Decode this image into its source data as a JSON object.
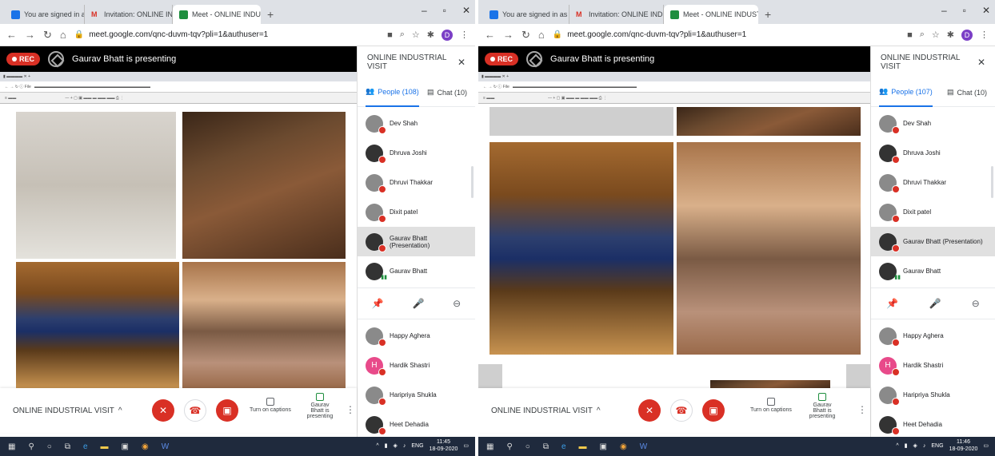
{
  "screens": [
    {
      "tabs": [
        {
          "label": "You are signed in as ce.dmm",
          "icon_color": "#1a73e8"
        },
        {
          "label": "Invitation: ONLINE INDUSTRIAL",
          "icon_color": "#d93025"
        },
        {
          "label": "Meet - ONLINE INDUSTRIAL",
          "icon_color": "#1e8e3e"
        }
      ],
      "url": "meet.google.com/qnc-duvm-tqv?pli=1&authuser=1",
      "presenter_banner": "Gaurav Bhatt is presenting",
      "rec_label": "REC",
      "panel_title": "ONLINE INDUSTRIAL VISIT",
      "people_tab": "People (108)",
      "chat_tab": "Chat (10)",
      "participants_top": [
        {
          "name": "Dev Shah"
        },
        {
          "name": "Dhruva Joshi"
        },
        {
          "name": "Dhruvi Thakkar"
        },
        {
          "name": "Dixit patel"
        },
        {
          "name": "Gaurav Bhatt (Presentation)"
        },
        {
          "name": "Gaurav Bhatt"
        }
      ],
      "participants_bottom": [
        {
          "name": "Happy Aghera"
        },
        {
          "name": "Hardik Shastri",
          "initial": "H"
        },
        {
          "name": "Haripriya Shukla"
        },
        {
          "name": "Heet Dehadia"
        }
      ],
      "meeting_name": "ONLINE INDUSTRIAL VISIT",
      "captions_label": "Turn on captions",
      "presenting_label": "Gaurav Bhatt is presenting",
      "tray_time": "11:45",
      "tray_date": "18-09-2020",
      "tray_lang": "ENG"
    },
    {
      "tabs": [
        {
          "label": "You are signed in as ce.dmm",
          "icon_color": "#1a73e8"
        },
        {
          "label": "Invitation: ONLINE INDUSTRIAL",
          "icon_color": "#d93025"
        },
        {
          "label": "Meet - ONLINE INDUSTRIAL",
          "icon_color": "#1e8e3e"
        }
      ],
      "url": "meet.google.com/qnc-duvm-tqv?pli=1&authuser=1",
      "presenter_banner": "Gaurav Bhatt is presenting",
      "rec_label": "REC",
      "panel_title": "ONLINE INDUSTRIAL VISIT",
      "people_tab": "People (107)",
      "chat_tab": "Chat (10)",
      "participants_top": [
        {
          "name": "Dev Shah"
        },
        {
          "name": "Dhruva Joshi"
        },
        {
          "name": "Dhruvi Thakkar"
        },
        {
          "name": "Dixit patel"
        },
        {
          "name": "Gaurav Bhatt (Presentation)"
        },
        {
          "name": "Gaurav Bhatt"
        }
      ],
      "participants_bottom": [
        {
          "name": "Happy Aghera"
        },
        {
          "name": "Hardik Shastri",
          "initial": "H"
        },
        {
          "name": "Haripriya Shukla"
        },
        {
          "name": "Heet Dehadia"
        }
      ],
      "meeting_name": "ONLINE INDUSTRIAL VISIT",
      "captions_label": "Turn on captions",
      "presenting_label": "Gaurav Bhatt is presenting",
      "tray_time": "11:46",
      "tray_date": "18-09-2020",
      "tray_lang": "ENG"
    }
  ]
}
